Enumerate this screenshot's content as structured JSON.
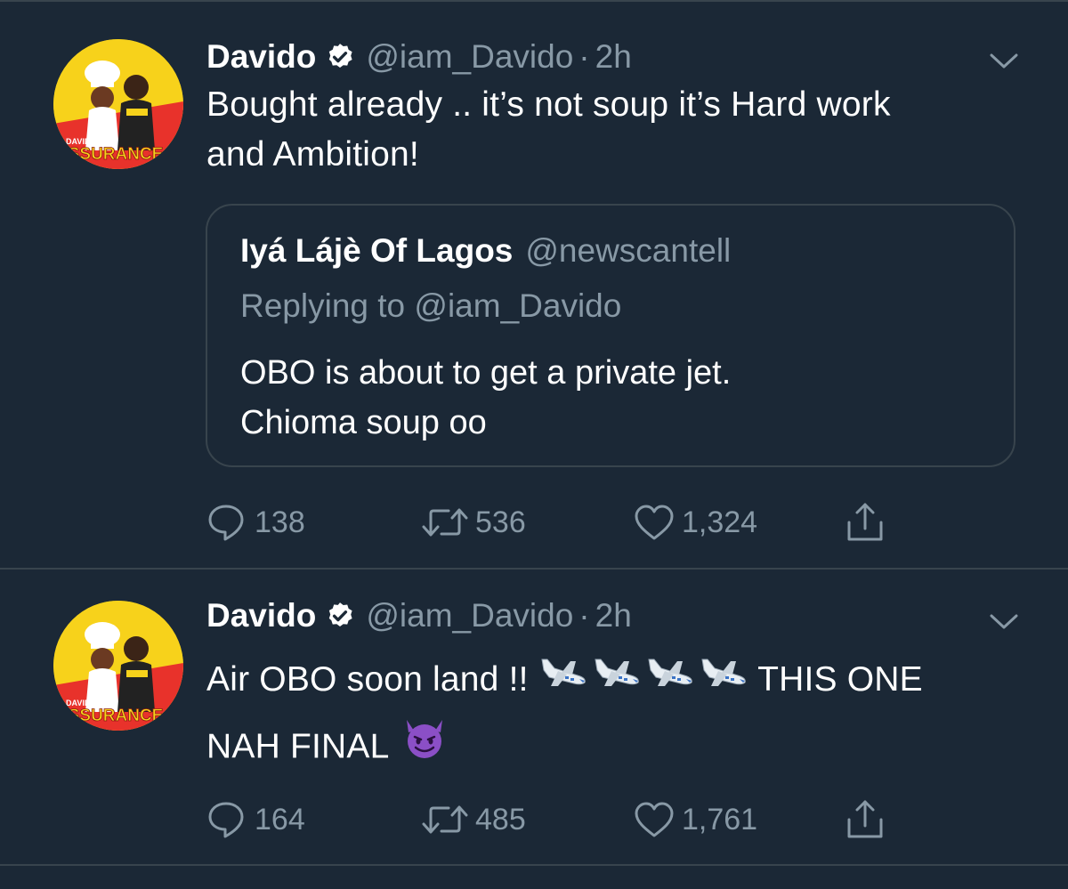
{
  "tweets": [
    {
      "author_name": "Davido",
      "author_handle": "@iam_Davido",
      "separator": "·",
      "time": "2h",
      "avatar_text_small": "DAVIDO",
      "avatar_text_large": "ASSURANCE",
      "text_lines": [
        "Bought already .. it’s not soup it’s Hard work",
        "and Ambition!"
      ],
      "quote": {
        "name": "Iyá Lájè Of Lagos",
        "handle": "@newscantell",
        "replying": "Replying to @iam_Davido",
        "text_lines": [
          "OBO is about to get a private jet.",
          "Chioma soup oo"
        ]
      },
      "replies": "138",
      "retweets": "536",
      "likes": "1,324"
    },
    {
      "author_name": "Davido",
      "author_handle": "@iam_Davido",
      "separator": "·",
      "time": "2h",
      "avatar_text_small": "DAVIDO",
      "avatar_text_large": "ASSURANCE",
      "text_line1_start": "Air OBO soon land !!",
      "text_line1_end": "THIS ONE",
      "text_line2": "NAH FINAL",
      "emoji_plane": "airplane-emoji",
      "emoji_devil": "smiling-devil-emoji",
      "replies": "164",
      "retweets": "485",
      "likes": "1,761"
    }
  ],
  "colors": {
    "background": "#1b2836",
    "text": "#ffffff",
    "secondary": "#8899a6",
    "border": "#38444d",
    "verified": "#ffffff"
  },
  "icons": [
    "verified-icon",
    "chevron-down-icon",
    "reply-icon",
    "retweet-icon",
    "like-icon",
    "share-icon"
  ]
}
